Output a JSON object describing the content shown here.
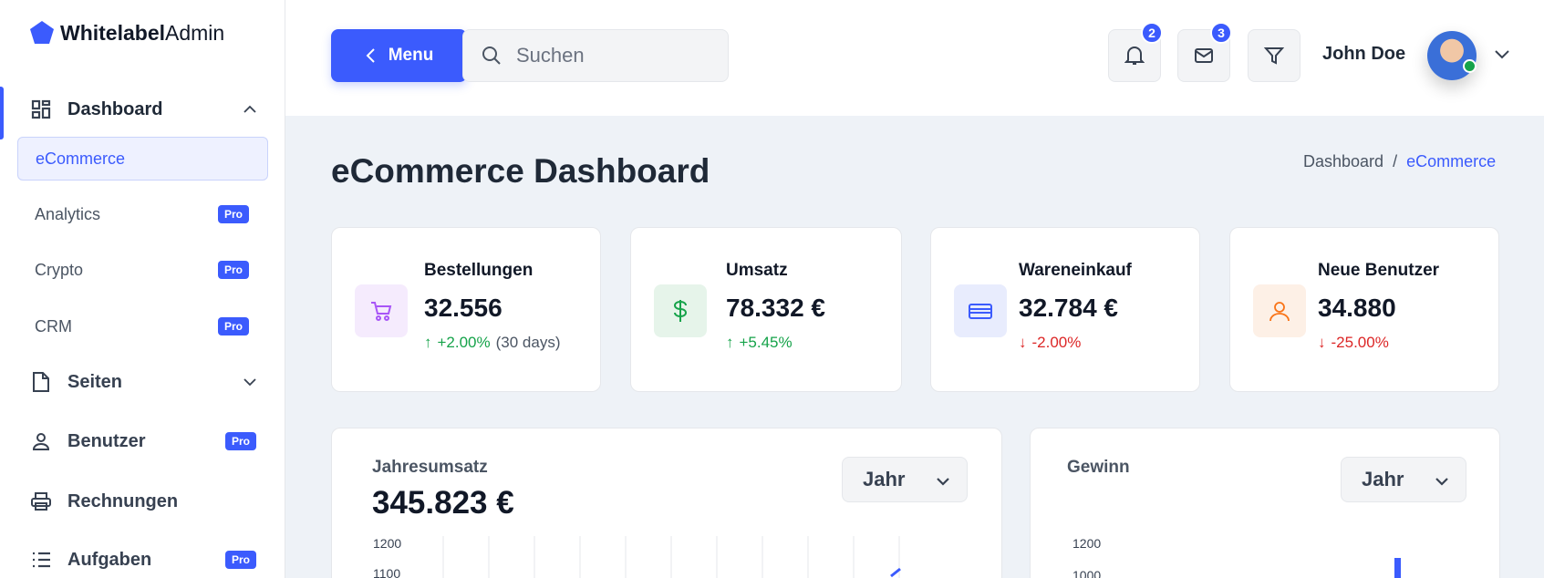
{
  "brand": {
    "bold": "Whitelabel",
    "light": "Admin"
  },
  "sidebar": {
    "dashboard": {
      "label": "Dashboard",
      "icon": "dashboard-icon"
    },
    "sub_items": [
      {
        "label": "eCommerce",
        "selected": true,
        "pro": ""
      },
      {
        "label": "Analytics",
        "pro": "Pro"
      },
      {
        "label": "Crypto",
        "pro": "Pro"
      },
      {
        "label": "CRM",
        "pro": "Pro"
      }
    ],
    "items": [
      {
        "label": "Seiten",
        "icon": "file-icon"
      },
      {
        "label": "Benutzer",
        "icon": "user-icon",
        "pro": "Pro"
      },
      {
        "label": "Rechnungen",
        "icon": "printer-icon"
      },
      {
        "label": "Aufgaben",
        "icon": "list-icon",
        "pro": "Pro"
      }
    ]
  },
  "header": {
    "menu_label": "Menu",
    "search_placeholder": "Suchen",
    "notifications_count": "2",
    "messages_count": "3",
    "user_name": "John Doe"
  },
  "page": {
    "title": "eCommerce Dashboard",
    "breadcrumb": {
      "root": "Dashboard",
      "separator": "/",
      "current": "eCommerce"
    }
  },
  "stats": [
    {
      "title": "Bestellungen",
      "value": "32.556",
      "change": "+2.00%",
      "note": "(30 days)",
      "trend": "up",
      "icon": "shopping-cart-icon",
      "color": "#a855f7",
      "bg": "#f5ebfd"
    },
    {
      "title": "Umsatz",
      "value": "78.332 €",
      "change": "+5.45%",
      "note": "",
      "trend": "up",
      "icon": "dollar-icon",
      "color": "#16a34a",
      "bg": "#e6f4ea"
    },
    {
      "title": "Wareneinkauf",
      "value": "32.784 €",
      "change": "-2.00%",
      "note": "",
      "trend": "down",
      "icon": "credit-card-icon",
      "color": "#3b5bfd",
      "bg": "#e8ecfd"
    },
    {
      "title": "Neue Benutzer",
      "value": "34.880",
      "change": "-25.00%",
      "note": "",
      "trend": "down",
      "icon": "user-icon",
      "color": "#f97316",
      "bg": "#fdf0e6"
    }
  ],
  "charts": {
    "revenue": {
      "title": "Jahresumsatz",
      "value": "345.823 €",
      "period": "Jahr",
      "ticks": [
        "1200",
        "1100"
      ]
    },
    "profit": {
      "title": "Gewinn",
      "period": "Jahr",
      "ticks": [
        "1200",
        "1000"
      ]
    }
  },
  "colors": {
    "accent": "#3b5bfd",
    "up": "#16a34a",
    "down": "#dc2626"
  }
}
